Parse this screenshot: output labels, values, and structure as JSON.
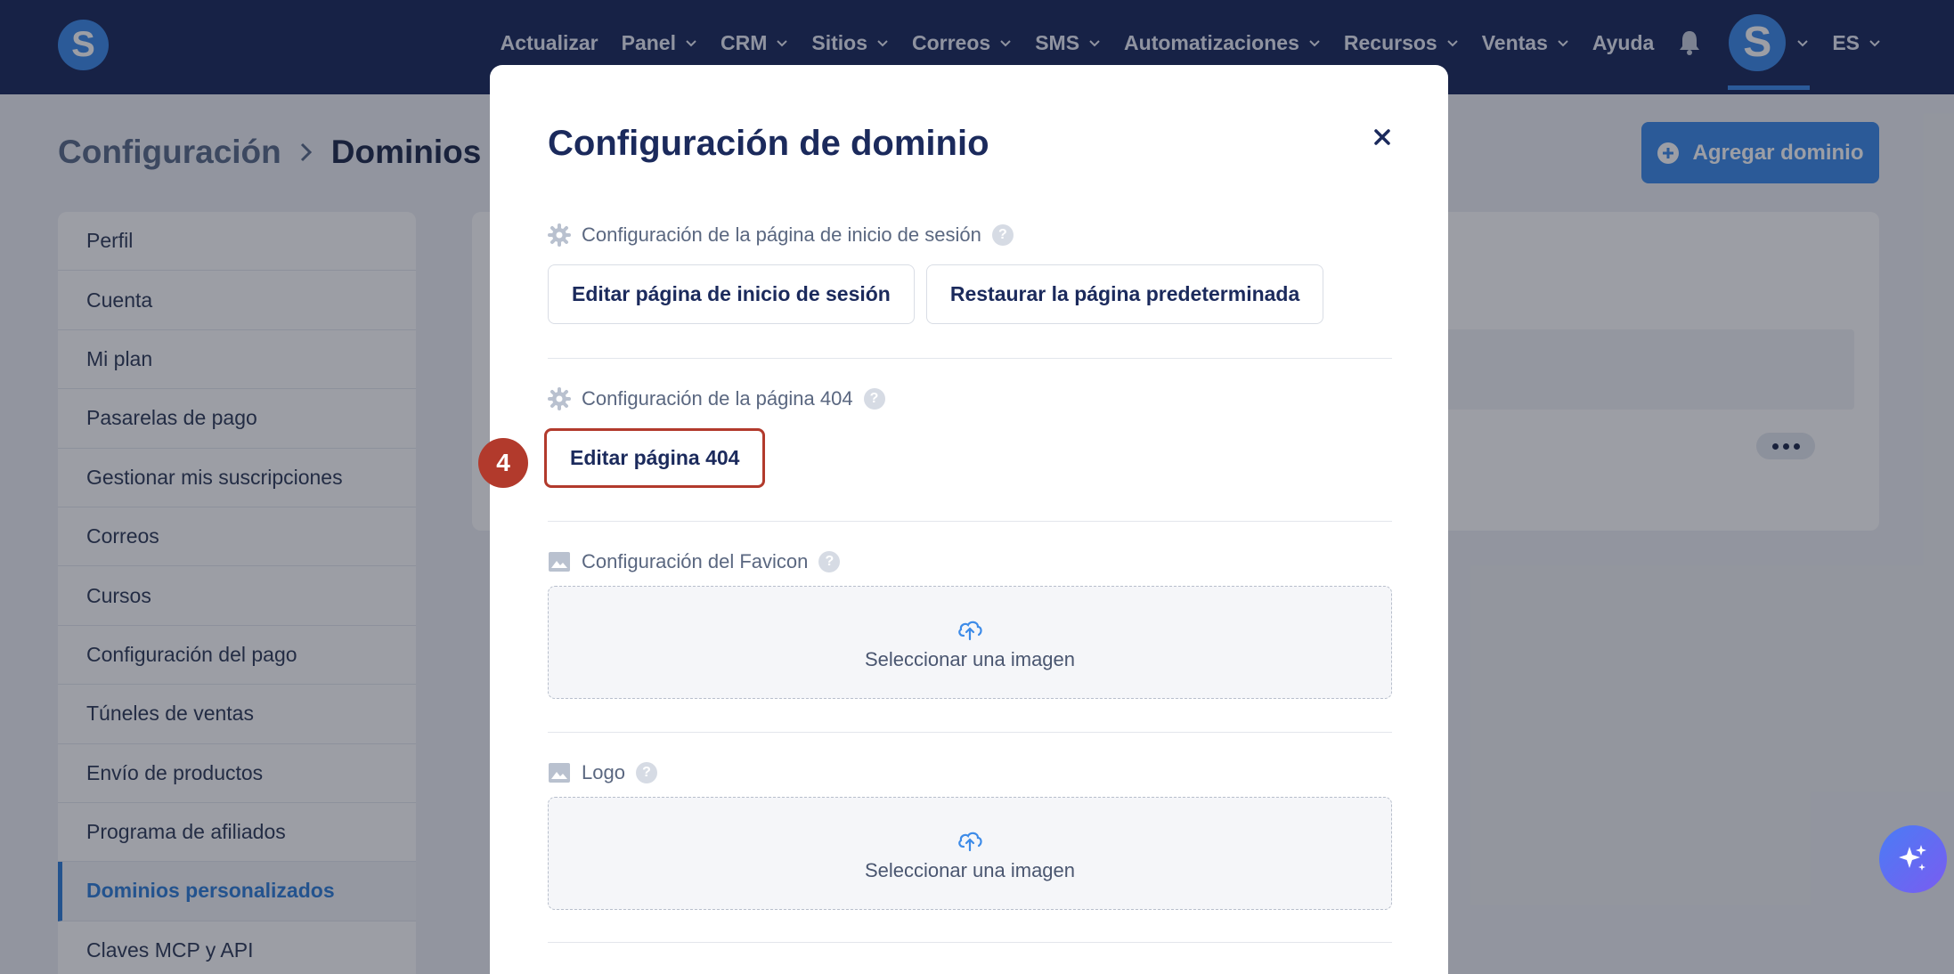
{
  "nav": {
    "logo_letter": "S",
    "items": [
      {
        "label": "Actualizar",
        "dropdown": false
      },
      {
        "label": "Panel",
        "dropdown": true
      },
      {
        "label": "CRM",
        "dropdown": true
      },
      {
        "label": "Sitios",
        "dropdown": true
      },
      {
        "label": "Correos",
        "dropdown": true
      },
      {
        "label": "SMS",
        "dropdown": true
      },
      {
        "label": "Automatizaciones",
        "dropdown": true
      },
      {
        "label": "Recursos",
        "dropdown": true
      },
      {
        "label": "Ventas",
        "dropdown": true
      },
      {
        "label": "Ayuda",
        "dropdown": false
      }
    ],
    "avatar_letter": "S",
    "language": "ES"
  },
  "breadcrumb": {
    "root": "Configuración",
    "current": "Dominios p"
  },
  "add_domain_label": "Agregar dominio",
  "sidebar": {
    "items": [
      {
        "label": "Perfil",
        "active": false
      },
      {
        "label": "Cuenta",
        "active": false
      },
      {
        "label": "Mi plan",
        "active": false
      },
      {
        "label": "Pasarelas de pago",
        "active": false
      },
      {
        "label": "Gestionar mis suscripciones",
        "active": false
      },
      {
        "label": "Correos",
        "active": false
      },
      {
        "label": "Cursos",
        "active": false
      },
      {
        "label": "Configuración del pago",
        "active": false
      },
      {
        "label": "Túneles de ventas",
        "active": false
      },
      {
        "label": "Envío de productos",
        "active": false
      },
      {
        "label": "Programa de afiliados",
        "active": false
      },
      {
        "label": "Dominios personalizados",
        "active": true
      },
      {
        "label": "Claves MCP y API",
        "active": false
      }
    ]
  },
  "modal": {
    "title": "Configuración de dominio",
    "login_section": {
      "heading": "Configuración de la página de inicio de sesión",
      "edit_label": "Editar página de inicio de sesión",
      "restore_label": "Restaurar la página predeterminada"
    },
    "page404_section": {
      "heading": "Configuración de la página 404",
      "edit_label": "Editar página 404"
    },
    "favicon_section": {
      "heading": "Configuración del Favicon",
      "upload_label": "Seleccionar una imagen"
    },
    "logo_section": {
      "heading": "Logo",
      "upload_label": "Seleccionar una imagen"
    },
    "help_glyph": "?"
  },
  "step_badge": "4",
  "colors": {
    "nav_bg": "#1b2a5c",
    "accent": "#3d8be8",
    "highlight": "#b23a2c"
  }
}
